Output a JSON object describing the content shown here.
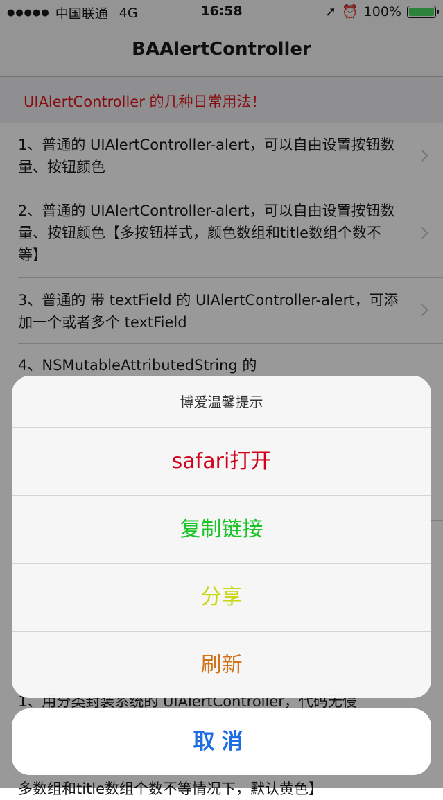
{
  "status_bar": {
    "signal_dots": "●●●●●",
    "carrier": "中国联通",
    "network": "4G",
    "time": "16:58",
    "location_icon": "➚",
    "alarm_icon": "⏰",
    "battery_percent": "100%",
    "battery_level": 1.0
  },
  "nav": {
    "title": "BAAlertController"
  },
  "list": {
    "section_header": "UIAlertController 的几种日常用法！",
    "items": [
      {
        "text": "1、普通的 UIAlertController-alert，可以自由设置按钮数量、按钮颜色"
      },
      {
        "text": "2、普通的 UIAlertController-alert，可以自由设置按钮数量、按钮颜色【多按钮样式，颜色数组和title数组个数不等】"
      },
      {
        "text": "3、普通的 带 textField 的 UIAlertController-alert，可添加一个或者多个 textField"
      },
      {
        "text": "4、NSMutableAttributedString 的"
      }
    ],
    "obscured_lines": [
      "1、用分类封装系统的 UIAlertController，代码无侵",
      "多数组和title数组个数不等情况下，默认黄色】"
    ]
  },
  "action_sheet": {
    "title": "博爱温馨提示",
    "actions": [
      {
        "label": "safari打开",
        "color": "#d0021b"
      },
      {
        "label": "复制链接",
        "color": "#19c427"
      },
      {
        "label": "分享",
        "color": "#c7d60e"
      },
      {
        "label": "刷新",
        "color": "#d2731a"
      }
    ],
    "cancel_label": "取消"
  },
  "colors": {
    "accent_red": "#e0161b",
    "cancel_blue": "#1d6ee2"
  }
}
